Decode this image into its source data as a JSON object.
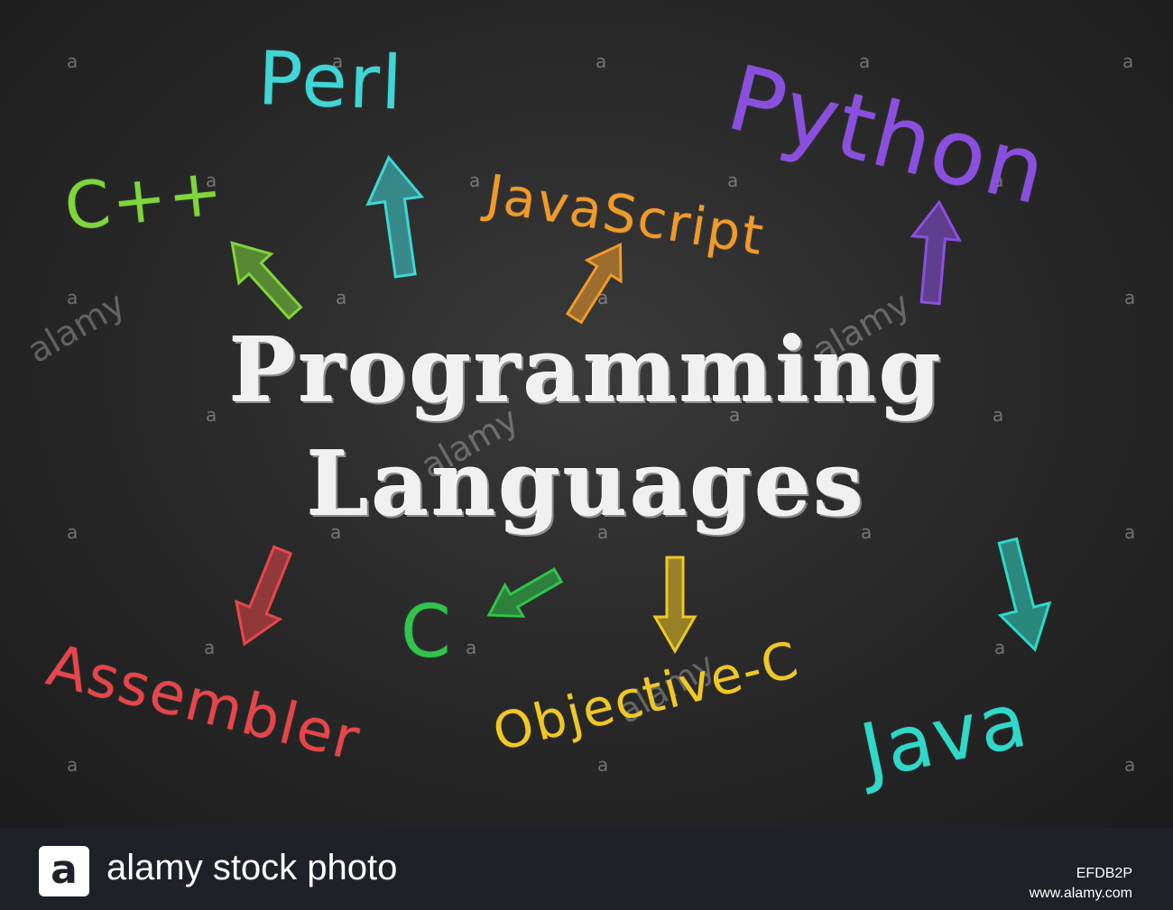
{
  "title": {
    "line1": "Programming",
    "line2": "Languages"
  },
  "languages": [
    {
      "key": "perl",
      "label": "Perl",
      "color": "#3fd6d6"
    },
    {
      "key": "python",
      "label": "Python",
      "color": "#8b4fe0"
    },
    {
      "key": "cpp",
      "label": "C++",
      "color": "#7ed63a"
    },
    {
      "key": "javascript",
      "label": "JavaScript",
      "color": "#f09a2a"
    },
    {
      "key": "assembler",
      "label": "Assembler",
      "color": "#e8454a"
    },
    {
      "key": "c",
      "label": "C",
      "color": "#2fc44a"
    },
    {
      "key": "objective_c",
      "label": "Objective-C",
      "color": "#f0c825"
    },
    {
      "key": "java",
      "label": "Java",
      "color": "#2fd8c8"
    }
  ],
  "arrow_icons": [
    {
      "key": "cpp",
      "name": "green-arrow-icon",
      "color": "#7ed63a"
    },
    {
      "key": "perl",
      "name": "cyan-arrow-icon",
      "color": "#3fd6d6"
    },
    {
      "key": "javascript",
      "name": "orange-arrow-icon",
      "color": "#f09a2a"
    },
    {
      "key": "python",
      "name": "purple-arrow-icon",
      "color": "#8b4fe0"
    },
    {
      "key": "assembler",
      "name": "red-arrow-icon",
      "color": "#e8454a"
    },
    {
      "key": "c",
      "name": "green-down-arrow-icon",
      "color": "#2fc44a"
    },
    {
      "key": "objective_c",
      "name": "yellow-arrow-icon",
      "color": "#f0c825"
    },
    {
      "key": "java",
      "name": "teal-arrow-icon",
      "color": "#2fd8c8"
    }
  ],
  "watermark": {
    "letter": "a",
    "word": "alamy"
  },
  "footer": {
    "logo_letter": "a",
    "brand": "alamy stock photo",
    "image_id": "EFDB2P",
    "url": "www.alamy.com"
  }
}
